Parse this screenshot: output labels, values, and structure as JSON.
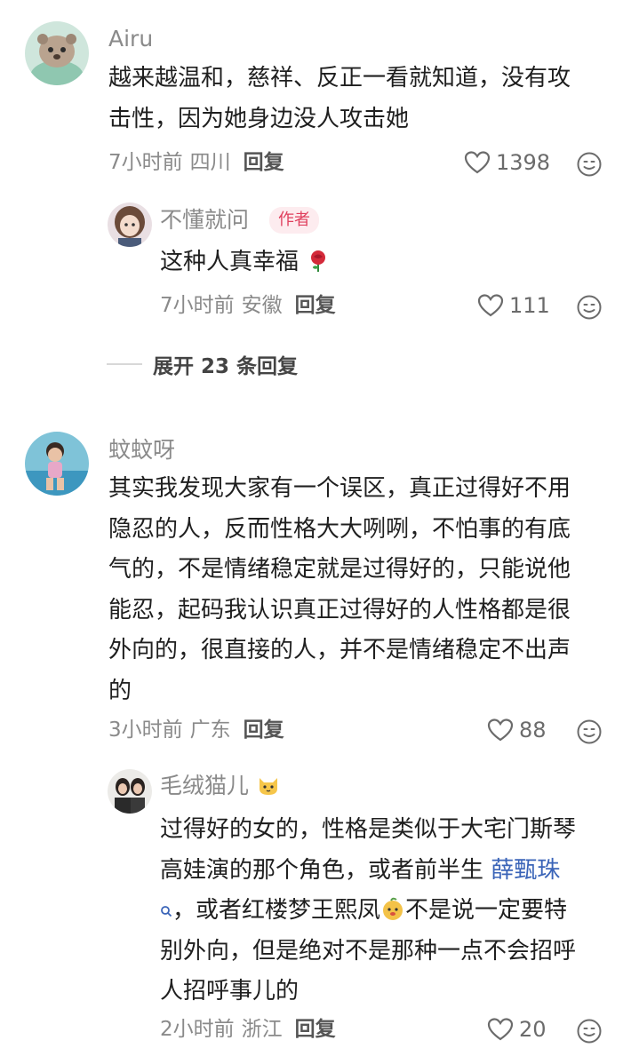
{
  "comments": [
    {
      "username": "Airu",
      "text_lines": [
        "越来越温和，慈祥、反正一看就知道，没有攻",
        "击性，因为她身边没人攻击她"
      ],
      "time": "7小时前",
      "location": "四川",
      "reply_label": "回复",
      "likes": "1398",
      "replies": [
        {
          "username": "不懂就问",
          "badge": "作者",
          "text": "这种人真幸福",
          "emoji": "rose",
          "time": "7小时前",
          "location": "安徽",
          "reply_label": "回复",
          "likes": "111"
        }
      ],
      "expand_label": "展开 23 条回复"
    },
    {
      "username": "蚊蚊呀",
      "text_lines": [
        "其实我发现大家有一个误区，真正过得好不用",
        "隐忍的人，反而性格大大咧咧，不怕事的有底",
        "气的，不是情绪稳定就是过得好的，只能说他",
        "能忍，起码我认识真正过得好的人性格都是很",
        "外向的，很直接的人，并不是情绪稳定不出声",
        "的"
      ],
      "time": "3小时前",
      "location": "广东",
      "reply_label": "回复",
      "likes": "88",
      "replies": [
        {
          "username": "毛绒猫儿",
          "username_emoji": "cat-face",
          "text_line1": "过得好的女的，性格是类似于大宅门斯琴",
          "text_line2a": "高娃演的那个角色，或者前半生 ",
          "text_link": "薛甄珠",
          "text_line3a": "，或者红楼梦王熙凤",
          "text_line3b": "不是说一定要特",
          "text_line4": "别外向，但是绝对不是那种一点不会招呼",
          "text_line5": "人招呼事儿的",
          "time": "2小时前",
          "location": "浙江",
          "reply_label": "回复",
          "likes": "20"
        }
      ]
    }
  ],
  "colors": {
    "secondary": "#8a8a8a",
    "badge": "#e0405e",
    "link": "#3a64b8"
  }
}
